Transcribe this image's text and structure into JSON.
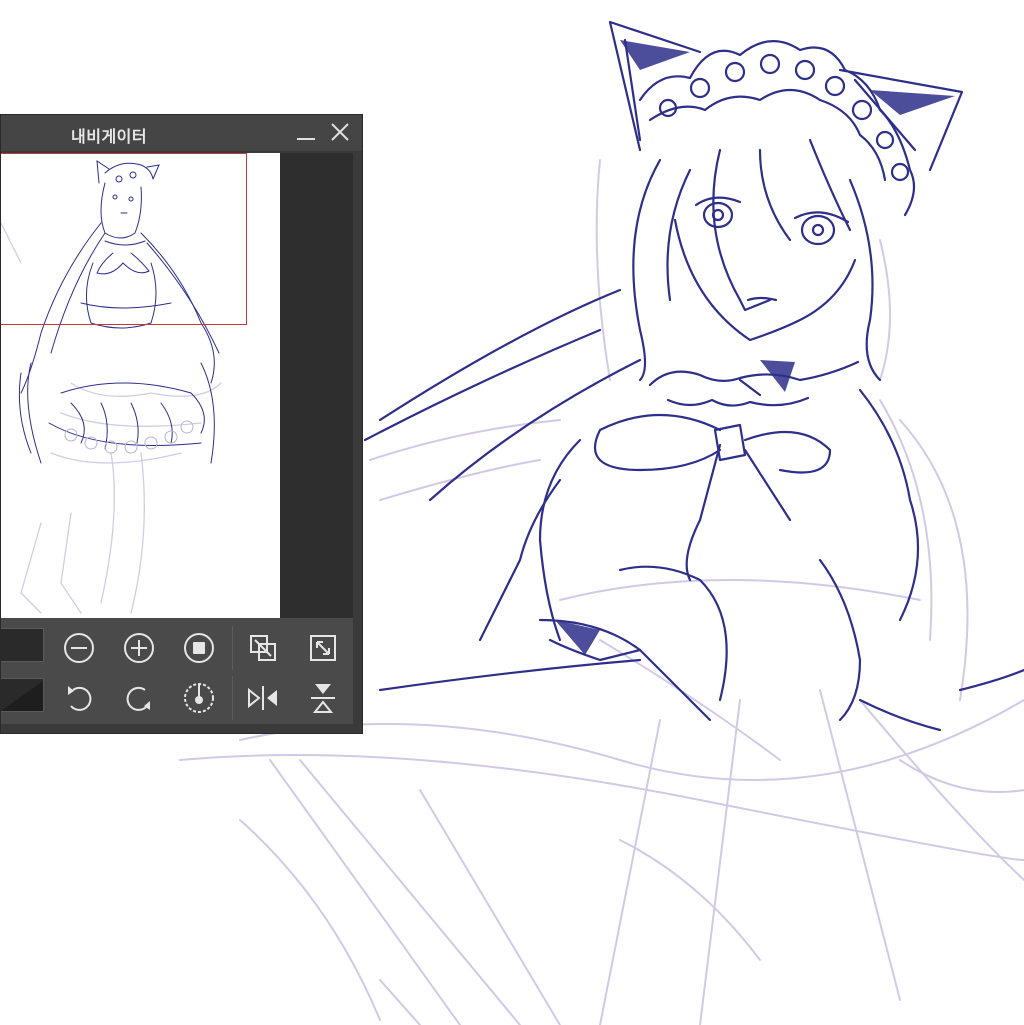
{
  "navigator": {
    "title": "내비게이터",
    "controls": {
      "row1": [
        "zoom-out-icon",
        "zoom-in-icon",
        "fit-screen-icon",
        "actual-size-icon",
        "fit-window-icon"
      ],
      "row2": [
        "rotate-left-icon",
        "rotate-right-icon",
        "reset-rotation-icon",
        "flip-horizontal-icon",
        "flip-vertical-icon"
      ]
    }
  },
  "colors": {
    "panel": "#3a3a3a",
    "titlebar": "#454545",
    "controls": "#4a4a4a",
    "viewport_frame": "#c0393b",
    "line_art": "#2d2f8a",
    "sketch": "#c9c0e0"
  }
}
